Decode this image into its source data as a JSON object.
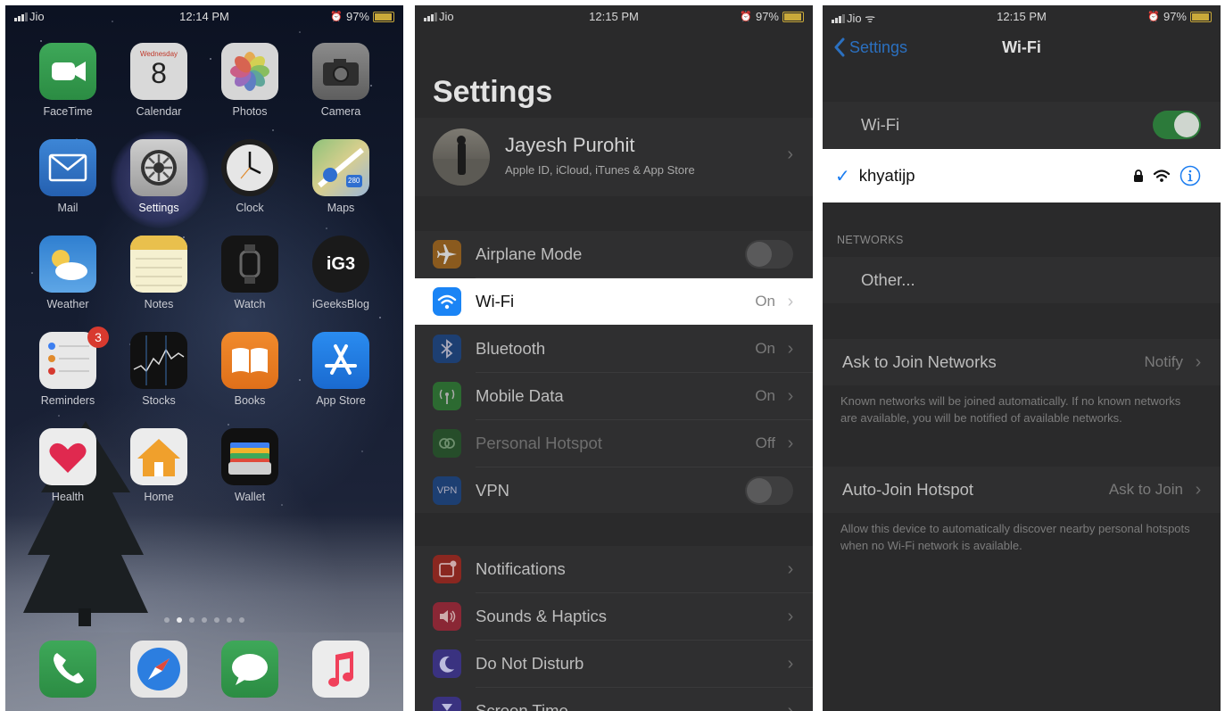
{
  "home": {
    "status": {
      "carrier": "Jio",
      "time": "12:14 PM",
      "battery": "97%"
    },
    "apps": [
      {
        "label": "FaceTime",
        "icon": "facetime-icon"
      },
      {
        "label": "Calendar",
        "icon": "calendar-icon",
        "weekday": "Wednesday",
        "day": "8"
      },
      {
        "label": "Photos",
        "icon": "photos-icon"
      },
      {
        "label": "Camera",
        "icon": "camera-icon"
      },
      {
        "label": "Mail",
        "icon": "mail-icon"
      },
      {
        "label": "Settings",
        "icon": "settings-gear-icon"
      },
      {
        "label": "Clock",
        "icon": "clock-icon"
      },
      {
        "label": "Maps",
        "icon": "maps-icon",
        "shield": "280"
      },
      {
        "label": "Weather",
        "icon": "weather-icon"
      },
      {
        "label": "Notes",
        "icon": "notes-icon"
      },
      {
        "label": "Watch",
        "icon": "watch-icon"
      },
      {
        "label": "iGeeksBlog",
        "icon": "igeeksblog-icon",
        "mark": "iG3"
      },
      {
        "label": "Reminders",
        "icon": "reminders-icon",
        "badge": "3"
      },
      {
        "label": "Stocks",
        "icon": "stocks-icon"
      },
      {
        "label": "Books",
        "icon": "books-icon"
      },
      {
        "label": "App Store",
        "icon": "app-store-icon"
      },
      {
        "label": "Health",
        "icon": "health-icon"
      },
      {
        "label": "Home",
        "icon": "home-icon"
      },
      {
        "label": "Wallet",
        "icon": "wallet-icon"
      }
    ],
    "dock": [
      "phone-icon",
      "safari-icon",
      "messages-icon",
      "music-icon"
    ],
    "page_dots": 7,
    "active_page": 2
  },
  "settings": {
    "status": {
      "carrier": "Jio",
      "time": "12:15 PM",
      "battery": "97%"
    },
    "title": "Settings",
    "profile": {
      "name": "Jayesh Purohit",
      "subtitle": "Apple ID, iCloud, iTunes & App Store"
    },
    "group1": [
      {
        "label": "Airplane Mode",
        "icon": "airplane-icon",
        "color": "#e08a2c",
        "toggle": false
      },
      {
        "label": "Wi-Fi",
        "icon": "wifi-icon",
        "color": "#1a84f5",
        "value": "On",
        "highlight": true
      },
      {
        "label": "Bluetooth",
        "icon": "bluetooth-icon",
        "color": "#2a66b8",
        "value": "On"
      },
      {
        "label": "Mobile Data",
        "icon": "antenna-icon",
        "color": "#3e9a45",
        "value": "On"
      },
      {
        "label": "Personal Hotspot",
        "icon": "hotspot-icon",
        "color": "#3e9a45",
        "value": "Off",
        "dim": true
      },
      {
        "label": "VPN",
        "icon": "vpn-icon",
        "color": "#2a5fb0",
        "toggle": false,
        "mark": "VPN"
      }
    ],
    "group2": [
      {
        "label": "Notifications",
        "icon": "notifications-icon",
        "color": "#d63a30"
      },
      {
        "label": "Sounds & Haptics",
        "icon": "speaker-icon",
        "color": "#d63a4a"
      },
      {
        "label": "Do Not Disturb",
        "icon": "moon-icon",
        "color": "#5a4ec7"
      },
      {
        "label": "Screen Time",
        "icon": "hourglass-icon",
        "color": "#5a4ec7"
      }
    ]
  },
  "wifi": {
    "status": {
      "carrier": "Jio",
      "time": "12:15 PM",
      "battery": "97%"
    },
    "back_label": "Settings",
    "title": "Wi-Fi",
    "wifi_label": "Wi-Fi",
    "wifi_on": true,
    "connected_network": "khyatijp",
    "networks_header": "NETWORKS",
    "other_label": "Other...",
    "ask_label": "Ask to Join Networks",
    "ask_value": "Notify",
    "ask_footer": "Known networks will be joined automatically. If no known networks are available, you will be notified of available networks.",
    "auto_label": "Auto-Join Hotspot",
    "auto_value": "Ask to Join",
    "auto_footer": "Allow this device to automatically discover nearby personal hotspots when no Wi-Fi network is available."
  },
  "colors": {
    "accent_blue": "#1a84f5",
    "switch_green": "#34c759",
    "dim_overlay": "#2a2a2b"
  }
}
